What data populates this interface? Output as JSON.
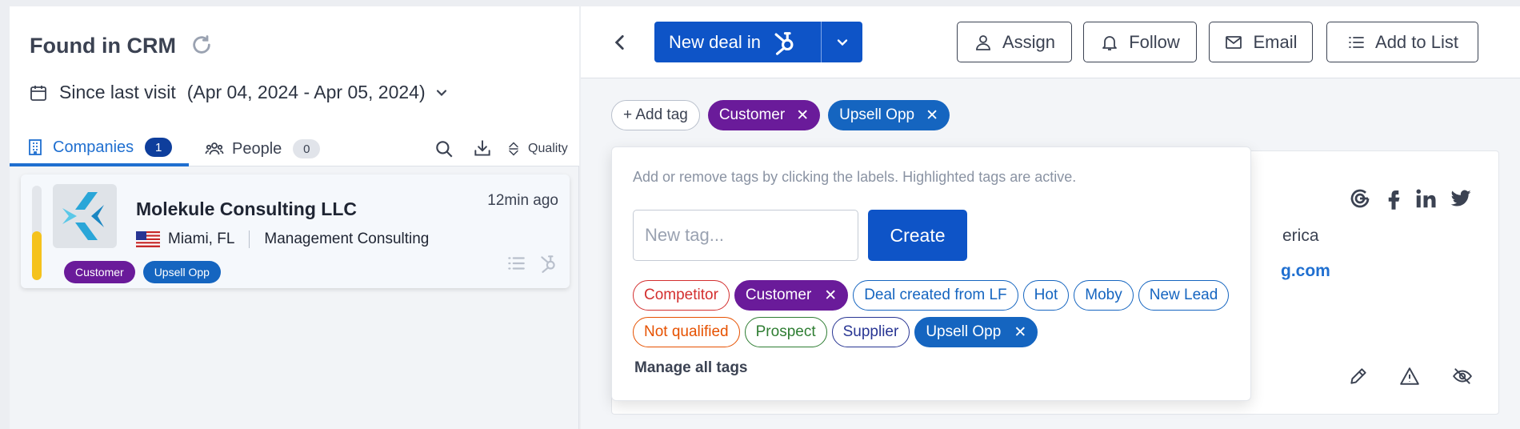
{
  "left": {
    "title": "Found in CRM",
    "since_label": "Since last visit",
    "since_range": "(Apr 04, 2024 - Apr 05, 2024)",
    "tabs": [
      {
        "label": "Companies",
        "count": "1"
      },
      {
        "label": "People",
        "count": "0"
      }
    ],
    "quality_label": "Quality",
    "company": {
      "name": "Molekule Consulting LLC",
      "location": "Miami, FL",
      "industry": "Management Consulting",
      "time_ago": "12min ago",
      "score_fraction": 0.52,
      "tags": [
        {
          "label": "Customer",
          "color": "#6a1b9a"
        },
        {
          "label": "Upsell Opp",
          "color": "#1565c0"
        }
      ]
    }
  },
  "toolbar": {
    "new_deal_label": "New deal in",
    "assign_label": "Assign",
    "follow_label": "Follow",
    "email_label": "Email",
    "add_to_list_label": "Add to List"
  },
  "tags": {
    "add_label": "+ Add tag",
    "active": [
      {
        "label": "Customer",
        "color": "#6a1b9a"
      },
      {
        "label": "Upsell Opp",
        "color": "#1565c0"
      }
    ],
    "remove_glyph": "✕"
  },
  "popover": {
    "hint": "Add or remove tags by clicking the labels. Highlighted tags are active.",
    "input_placeholder": "New tag...",
    "create_label": "Create",
    "manage_label": "Manage all tags",
    "tags": [
      {
        "label": "Competitor",
        "color": "#d32f2f",
        "active": false
      },
      {
        "label": "Customer",
        "color": "#6a1b9a",
        "active": true
      },
      {
        "label": "Deal created from LF",
        "color": "#1565c0",
        "active": false
      },
      {
        "label": "Hot",
        "color": "#1565c0",
        "active": false
      },
      {
        "label": "Moby",
        "color": "#1565c0",
        "active": false
      },
      {
        "label": "New Lead",
        "color": "#1565c0",
        "active": false
      },
      {
        "label": "Not qualified",
        "color": "#e65100",
        "active": false
      },
      {
        "label": "Prospect",
        "color": "#2e7d32",
        "active": false
      },
      {
        "label": "Supplier",
        "color": "#283593",
        "active": false
      },
      {
        "label": "Upsell Opp",
        "color": "#1565c0",
        "active": true
      }
    ]
  },
  "background_card": {
    "country_fragment": "erica",
    "website_fragment": "g.com"
  }
}
